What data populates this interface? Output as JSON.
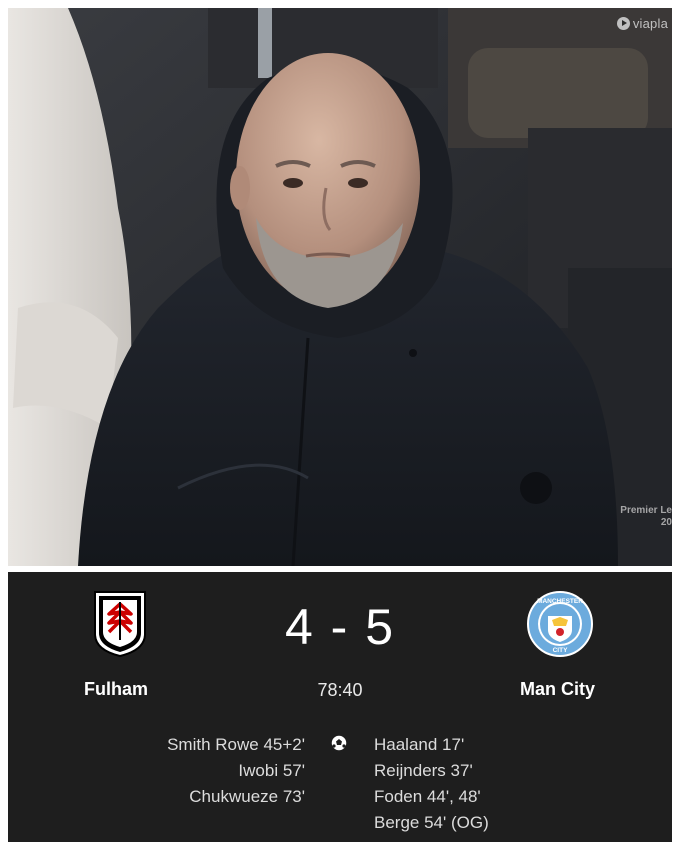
{
  "photo": {
    "broadcaster_watermark": "viapla",
    "competition_watermark_line1": "Premier Le",
    "competition_watermark_line2": "20"
  },
  "match": {
    "home_team": "Fulham",
    "away_team": "Man City",
    "home_score": "4",
    "separator": "-",
    "away_score": "5",
    "clock": "78:40",
    "home_scorers": [
      "Smith Rowe 45+2'",
      "Iwobi 57'",
      "Chukwueze 73'"
    ],
    "away_scorers": [
      "Haaland 17'",
      "Reijnders 37'",
      "Foden 44', 48'",
      "Berge 54' (OG)"
    ]
  },
  "crests": {
    "home_icon": "fulham-crest-icon",
    "away_icon": "man-city-crest-icon",
    "away_ring_text_top": "MANCHESTER",
    "away_ring_text_bottom": "CITY"
  },
  "colors": {
    "scoreboard_bg": "#1e1e1e",
    "text": "#ffffff",
    "fulham_red": "#cc0000",
    "city_blue": "#6cabdd"
  }
}
